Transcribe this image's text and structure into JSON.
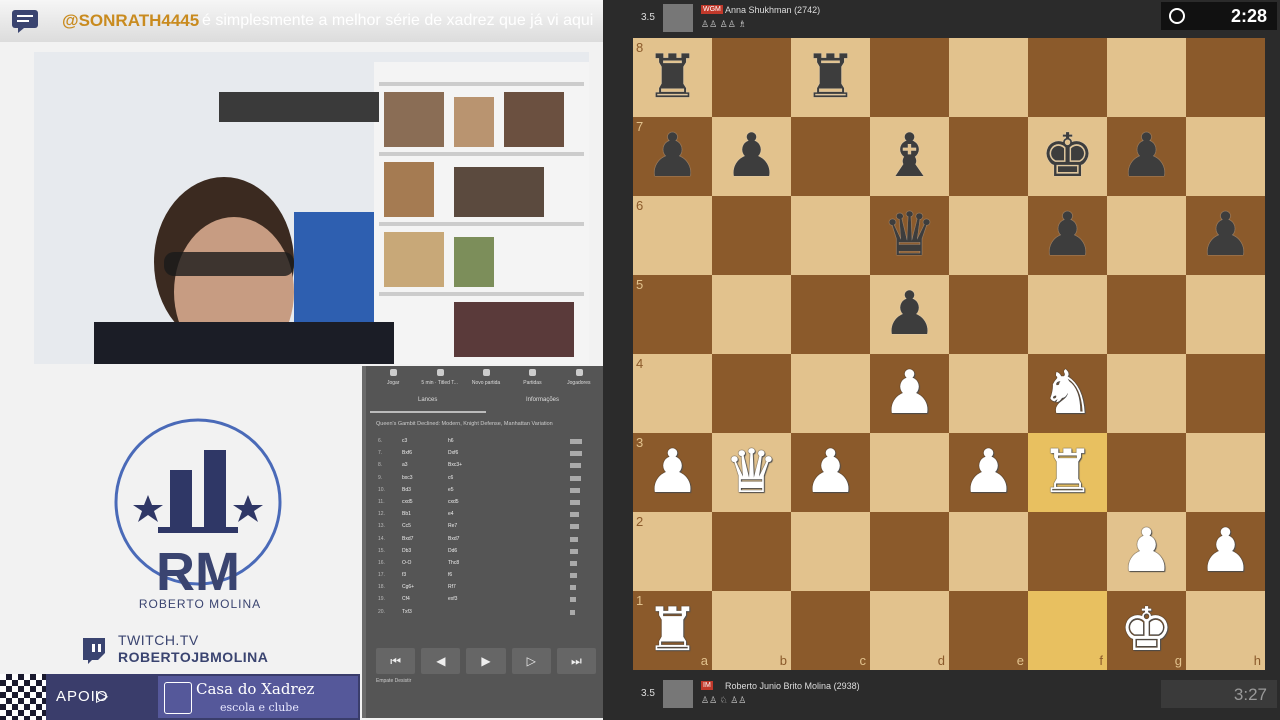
{
  "chat": {
    "username": "@SONRATH4445",
    "message": "é simplesmente a melhor série de xadrez que já vi aqui"
  },
  "logo": {
    "initials": "RM",
    "name": "ROBERTO MOLINA"
  },
  "twitch": {
    "line1": "TWITCH.TV",
    "line2": "ROBERTOJBMOLINA"
  },
  "sponsor": {
    "label": "APOIO",
    "name": "Casa do Xadrez",
    "subtitle": "escola e clube"
  },
  "move_panel": {
    "nav": [
      "Jogar",
      "5 min · Titled T...",
      "Novo partida",
      "Partidas",
      "Jogadores"
    ],
    "tabs": [
      "Lances",
      "Informações"
    ],
    "opening": "Queen's Gambit Declined: Modern, Knight Defense, Manhattan Variation",
    "moves": [
      {
        "n": "6.",
        "w": "c3",
        "b": "h6"
      },
      {
        "n": "7.",
        "w": "Bxf6",
        "b": "Dxf6"
      },
      {
        "n": "8.",
        "w": "a3",
        "b": "Bxc3+"
      },
      {
        "n": "9.",
        "w": "bxc3",
        "b": "c6"
      },
      {
        "n": "10.",
        "w": "Bd3",
        "b": "e5"
      },
      {
        "n": "11.",
        "w": "cxd5",
        "b": "cxd5"
      },
      {
        "n": "12.",
        "w": "Bb1",
        "b": "e4"
      },
      {
        "n": "13.",
        "w": "Cc5",
        "b": "Re7"
      },
      {
        "n": "14.",
        "w": "Bxd7",
        "b": "Bxd7"
      },
      {
        "n": "15.",
        "w": "Db3",
        "b": "Dd6"
      },
      {
        "n": "16.",
        "w": "O-O",
        "b": "Thc8"
      },
      {
        "n": "17.",
        "w": "f3",
        "b": "f6"
      },
      {
        "n": "18.",
        "w": "Cg6+",
        "b": "Rf7"
      },
      {
        "n": "19.",
        "w": "Cf4",
        "b": "exf3"
      },
      {
        "n": "20.",
        "w": "Txf3",
        "b": ""
      }
    ],
    "controls": [
      "⏮",
      "◀",
      "▶",
      "▷",
      "⏭"
    ],
    "footer": "Empate   Desistir"
  },
  "top_player": {
    "score": "3.5",
    "title": "WGM",
    "name": "Anna Shukhman",
    "rating": "(2742)",
    "clock": "2:28"
  },
  "bottom_player": {
    "score": "3.5",
    "title": "IM",
    "name": "Roberto Junio Brito Molina",
    "rating": "(2938)",
    "clock": "3:27"
  },
  "board": {
    "files": [
      "a",
      "b",
      "c",
      "d",
      "e",
      "f",
      "g",
      "h"
    ],
    "ranks": [
      "8",
      "7",
      "6",
      "5",
      "4",
      "3",
      "2",
      "1"
    ],
    "position": [
      [
        "br",
        "",
        "br",
        "",
        "",
        "",
        "",
        ""
      ],
      [
        "bp",
        "bp",
        "",
        "bb",
        "",
        "bk",
        "bp",
        ""
      ],
      [
        "",
        "",
        "",
        "bq",
        "",
        "bp",
        "",
        "bp"
      ],
      [
        "",
        "",
        "",
        "bp",
        "",
        "",
        "",
        ""
      ],
      [
        "",
        "",
        "",
        "wp",
        "",
        "wn",
        "",
        ""
      ],
      [
        "wp",
        "wq",
        "wp",
        "",
        "wp",
        "wr",
        "",
        ""
      ],
      [
        "",
        "",
        "",
        "",
        "",
        "",
        "wp",
        "wp"
      ],
      [
        "wr",
        "",
        "",
        "",
        "",
        "",
        "wk",
        ""
      ]
    ],
    "highlight": [
      "f3",
      "f1"
    ]
  }
}
